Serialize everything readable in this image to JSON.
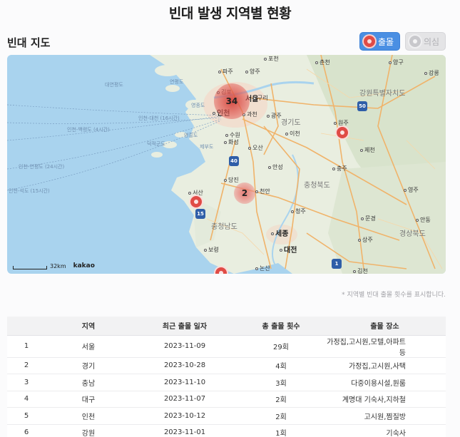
{
  "page": {
    "title": "빈대 발생 지역별 현황",
    "section_title": "빈대 지도"
  },
  "filters": {
    "outbreak_label": "출몰",
    "suspect_label": "의심"
  },
  "colors": {
    "accent": "#4a8fe3",
    "marker": "#e04b46",
    "cluster": "#d6423a"
  },
  "map": {
    "clusters": [
      {
        "count": "34"
      },
      {
        "count": "2"
      }
    ],
    "labels": {
      "paju": "파주",
      "yangju": "양주",
      "pocheon": "포천",
      "chuncheon": "춘천",
      "yanggu": "양구",
      "gangneung": "강릉",
      "gimpo": "김포",
      "seoul": "서울",
      "incheon": "인천",
      "guri": "구리",
      "gwacheon": "과천",
      "gwangju": "광주",
      "gangwon": "강원특별자치도",
      "gyeonggi": "경기도",
      "wonju": "원주",
      "suwon": "수원",
      "icheon": "이천",
      "hwaseong": "화성",
      "osan": "오산",
      "jecheon": "제천",
      "anseong": "안성",
      "chungju": "충주",
      "dangjin": "당진",
      "cheonan": "천안",
      "chungbuk": "충청북도",
      "yeongju": "영주",
      "seosan": "서산",
      "cheongju": "청주",
      "chungnam": "충청남도",
      "mungyeong": "문경",
      "andong": "안동",
      "sejong": "세종",
      "daejeon": "대전",
      "gyeongbuk": "경상북도",
      "sangju": "상주",
      "boryeong": "보령",
      "nonsan": "논산",
      "gimcheon": "김천",
      "daeyeon": "대연평도",
      "yeonpyeong": "연평도",
      "yeongjong": "영종도",
      "deokjeok": "덕적군도",
      "yeongheung": "영흥도",
      "jebu": "제부도",
      "route1": "인천-대천 (16시간)",
      "route2": "인천-백령도 (4시간)",
      "route3": "인천-연평도 (24시간)",
      "route4": "인천-석도 (15시간)",
      "badge_50": "50",
      "badge_40": "40",
      "badge_15": "15",
      "badge_1": "1"
    },
    "scale_label": "32km",
    "attribution": "kakao"
  },
  "note": "* 지역별 빈대 출몰 횟수를 표시합니다.",
  "table": {
    "headers": [
      "",
      "지역",
      "최근 출몰 일자",
      "총 출몰 횟수",
      "출몰 장소"
    ],
    "rows": [
      {
        "no": "1",
        "region": "서울",
        "date": "2023-11-09",
        "count": "29회",
        "place": "가정집,고시원,모텔,아파트 등"
      },
      {
        "no": "2",
        "region": "경기",
        "date": "2023-10-28",
        "count": "4회",
        "place": "가정집,고시원,사택"
      },
      {
        "no": "3",
        "region": "충남",
        "date": "2023-11-10",
        "count": "3회",
        "place": "다중이용시설,원룸"
      },
      {
        "no": "4",
        "region": "대구",
        "date": "2023-11-07",
        "count": "2회",
        "place": "계명대 기숙사,지하철"
      },
      {
        "no": "5",
        "region": "인천",
        "date": "2023-10-12",
        "count": "2회",
        "place": "고시원,찜질방"
      },
      {
        "no": "6",
        "region": "강원",
        "date": "2023-11-01",
        "count": "1회",
        "place": "기숙사"
      }
    ]
  }
}
